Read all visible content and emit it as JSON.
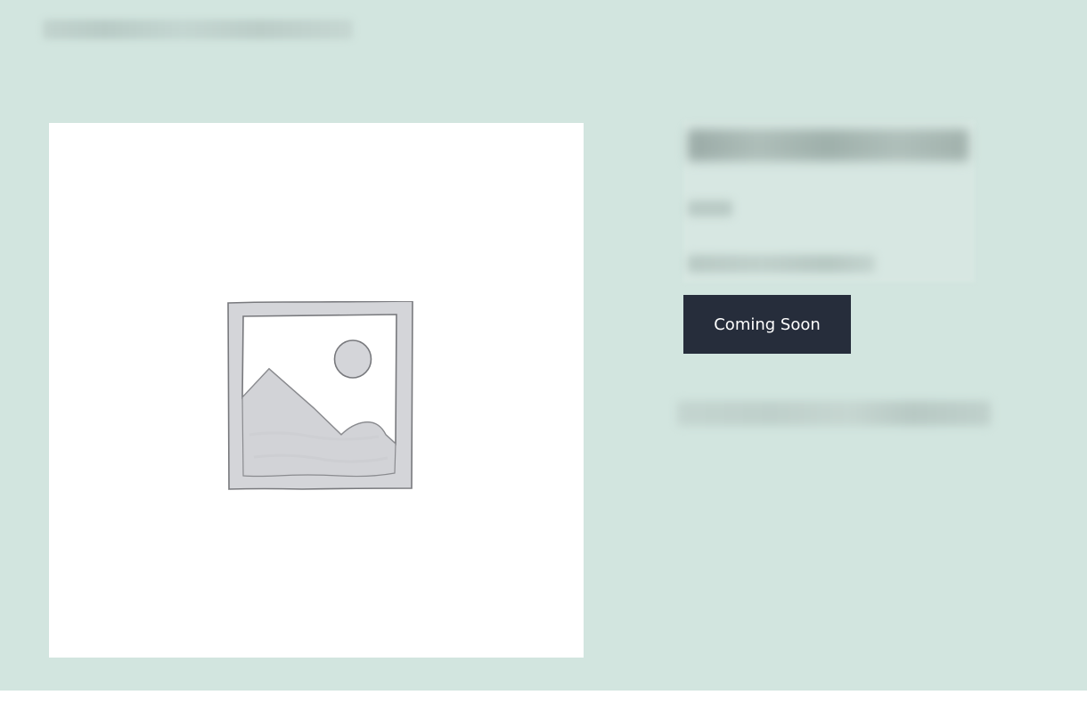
{
  "breadcrumb": {
    "text": ""
  },
  "product": {
    "image_icon": "image-placeholder-icon",
    "title": "",
    "price": "",
    "stock_status": "",
    "cta_label": "Coming Soon",
    "meta": ""
  },
  "colors": {
    "page_background": "#d2e5df",
    "button_background": "#262d3b",
    "button_text": "#ffffff",
    "image_background": "#ffffff"
  }
}
